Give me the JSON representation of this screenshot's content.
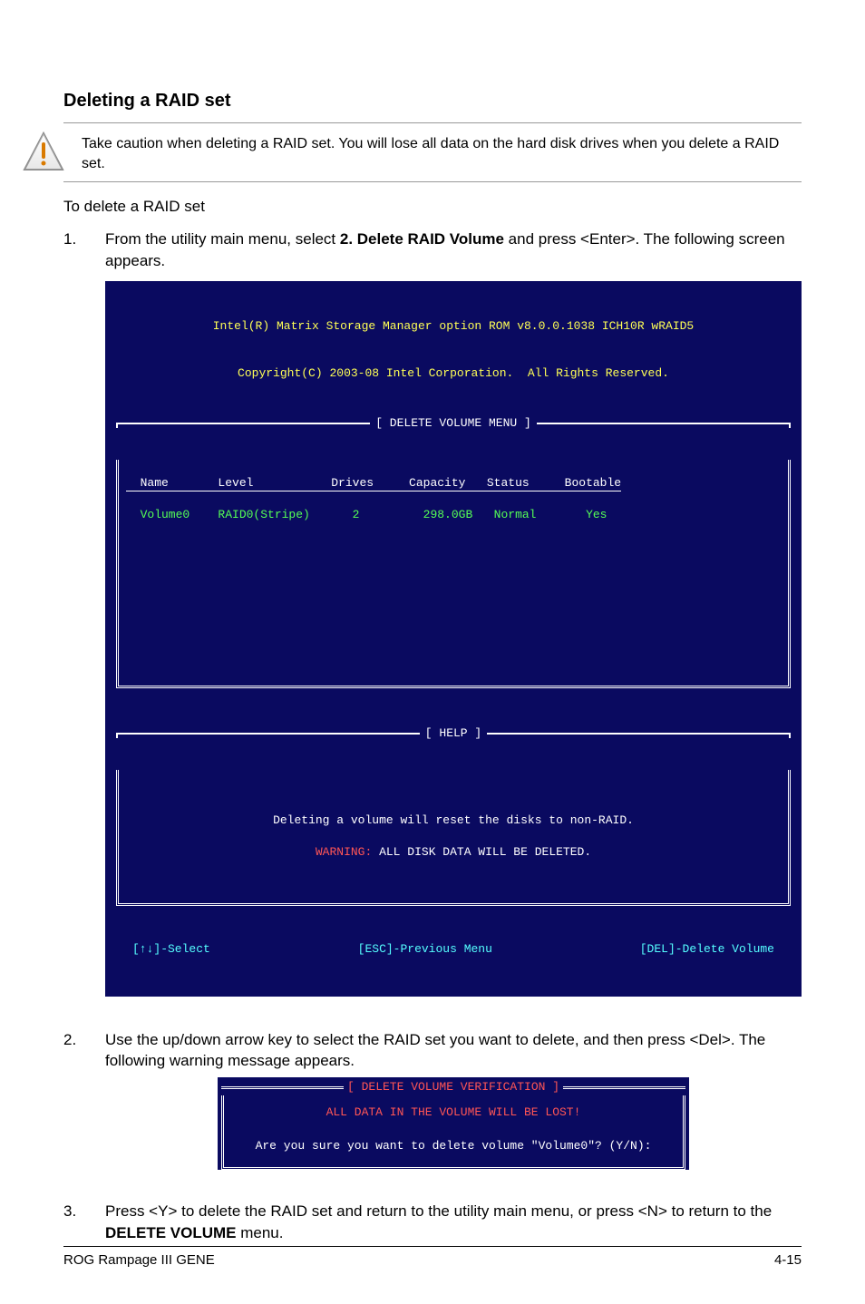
{
  "doc": {
    "title": "Deleting a RAID set",
    "caution": "Take caution when deleting a RAID set. You will lose all data on the hard disk drives when you delete a RAID set.",
    "subtitle": "To delete a RAID set",
    "step1_a": "From the utility main menu, select ",
    "step1_b": "2. Delete RAID Volume",
    "step1_c": " and press <Enter>. The following screen appears.",
    "step2": "Use the up/down arrow key to select the RAID set you want to delete, and then press <Del>. The following warning message appears.",
    "step3_a": "Press <Y> to delete the RAID set and return to the utility main menu, or press <N> to return to the ",
    "step3_b": "DELETE VOLUME",
    "step3_c": " menu."
  },
  "bios": {
    "hdr1": "Intel(R) Matrix Storage Manager option ROM v8.0.0.1038 ICH10R wRAID5",
    "hdr2": "Copyright(C) 2003-08 Intel Corporation.  All Rights Reserved.",
    "menuTitle": "[ DELETE VOLUME MENU ]",
    "helpTitle": "[ HELP ]",
    "table": {
      "headers": "  Name       Level           Drives     Capacity   Status     Bootable",
      "row": "  Volume0    RAID0(Stripe)      2         298.0GB   Normal       Yes   "
    },
    "help1": "Deleting a volume will reset the disks to non-RAID.",
    "help2_prefix": "WARNING:",
    "help2_rest": " ALL DISK DATA WILL BE DELETED.",
    "footer": {
      "a": "[↑↓]-Select",
      "b": "[ESC]-Previous Menu",
      "c": "[DEL]-Delete Volume"
    }
  },
  "dialog": {
    "title": "[ DELETE VOLUME VERIFICATION ]",
    "line1": "ALL DATA IN THE VOLUME WILL BE LOST!",
    "line2": "Are you sure you want to delete volume \"Volume0\"? (Y/N):"
  },
  "footer": {
    "left": "ROG Rampage III GENE",
    "right": "4-15"
  }
}
